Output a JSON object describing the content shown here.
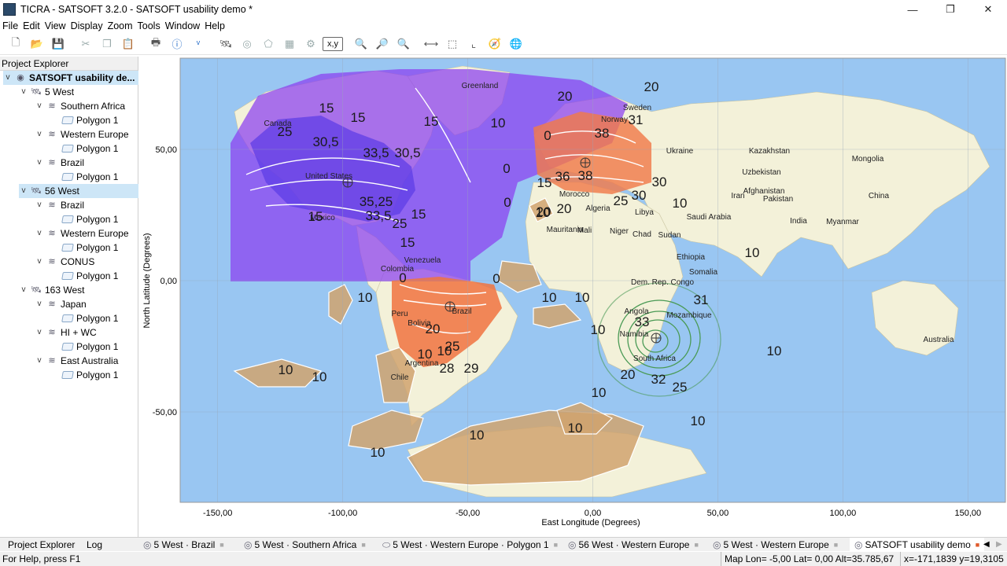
{
  "window": {
    "title": "TICRA - SATSOFT 3.2.0 - SATSOFT usability demo *",
    "minimize": "—",
    "maximize": "❐",
    "close": "✕"
  },
  "menu": [
    "File",
    "Edit",
    "View",
    "Display",
    "Zoom",
    "Tools",
    "Window",
    "Help"
  ],
  "toolbar": {
    "xy_label": "x,y"
  },
  "explorer": {
    "title": "Project Explorer",
    "root": "SATSOFT usability de...",
    "tree": [
      {
        "label": "5 West",
        "children": [
          {
            "label": "Southern Africa",
            "children": [
              "Polygon 1"
            ]
          },
          {
            "label": "Western Europe",
            "children": [
              "Polygon 1"
            ]
          },
          {
            "label": "Brazil",
            "children": [
              "Polygon 1"
            ]
          }
        ]
      },
      {
        "label": "56 West",
        "children": [
          {
            "label": "Brazil",
            "children": [
              "Polygon 1"
            ]
          },
          {
            "label": "Western Europe",
            "children": [
              "Polygon 1"
            ]
          },
          {
            "label": "CONUS",
            "children": [
              "Polygon 1"
            ]
          }
        ]
      },
      {
        "label": "163 West",
        "children": [
          {
            "label": "Japan",
            "children": [
              "Polygon 1"
            ]
          },
          {
            "label": "HI + WC",
            "children": [
              "Polygon 1"
            ]
          },
          {
            "label": "East Australia",
            "children": [
              "Polygon 1"
            ]
          }
        ]
      }
    ]
  },
  "map": {
    "ylabel": "North Latitude (Degrees)",
    "xlabel": "East Longitude (Degrees)",
    "xticks": [
      "-150,00",
      "-100,00",
      "-50,00",
      "0,00",
      "50,00",
      "100,00",
      "150,00"
    ],
    "yticks": [
      "50,00",
      "0,00",
      "-50,00"
    ],
    "places": [
      "Greenland",
      "Canada",
      "United States",
      "Mexico",
      "Venezuela",
      "Colombia",
      "Peru",
      "Bolivia",
      "Brazil",
      "Argentina",
      "Chile",
      "Sweden",
      "Norway",
      "Ukraine",
      "Kazakhstan",
      "Mongolia",
      "Uzbekistan",
      "China",
      "Afghanistan",
      "Iran",
      "Pakistan",
      "India",
      "Myanmar",
      "Morocco",
      "Algeria",
      "Libya",
      "Saudi Arabia",
      "Mauritania",
      "Mali",
      "Niger",
      "Chad",
      "Sudan",
      "Ethiopia",
      "Somalia",
      "Dem. Rep. Congo",
      "Angola",
      "Mozambique",
      "Namibia",
      "South Africa",
      "Australia"
    ],
    "contour_labels": [
      "20",
      "20",
      "15",
      "15",
      "15",
      "25",
      "30,5",
      "33,5",
      "30,5",
      "10",
      "0",
      "31",
      "38",
      "36",
      "38",
      "0",
      "15",
      "25",
      "30",
      "30",
      "10",
      "0",
      "10",
      "35,25",
      "33,5",
      "25",
      "15",
      "15",
      "20",
      "20",
      "10",
      "15",
      "0",
      "0",
      "10",
      "20",
      "10",
      "10",
      "25",
      "10",
      "28",
      "29",
      "10",
      "10",
      "10",
      "10",
      "33",
      "31",
      "10",
      "20",
      "32",
      "25",
      "10",
      "10",
      "10",
      "10",
      "10"
    ]
  },
  "bottom_tabs": {
    "left": [
      "Project Explorer",
      "Log"
    ],
    "docs": [
      "5 West · Brazil",
      "5 West · Southern Africa",
      "5 West · Western Europe · Polygon 1",
      "56 West · Western Europe",
      "5 West · Western Europe",
      "SATSOFT usability demo"
    ]
  },
  "status": {
    "help": "For Help, press F1",
    "map_coords": "Map Lon= -5,00 Lat= 0,00 Alt=35.785,67",
    "xy": "x=-171,1839 y=19,3105"
  }
}
